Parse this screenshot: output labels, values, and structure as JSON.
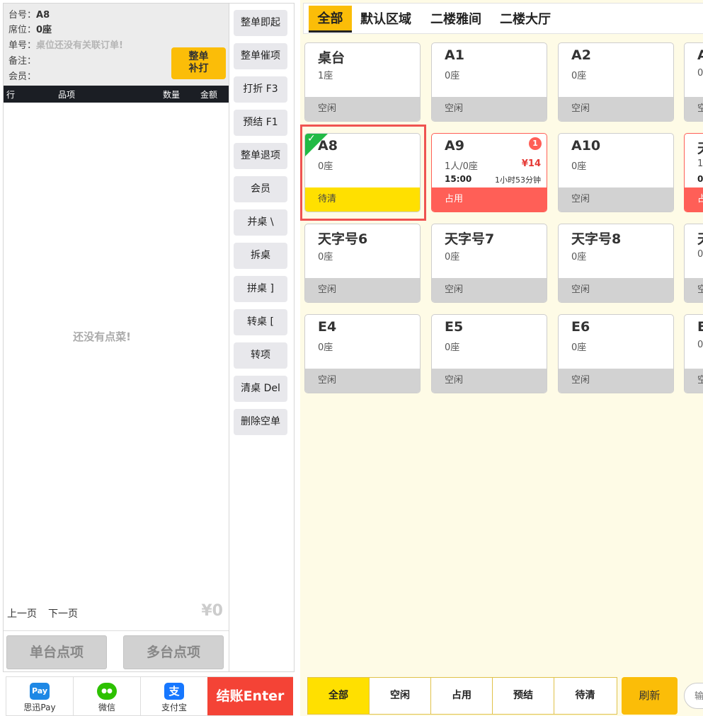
{
  "order": {
    "table_label": "台号：",
    "table_value": "A8",
    "seat_label": "席位：",
    "seat_value": "0座",
    "bill_label": "单号：",
    "bill_value": "桌位还没有关联订单!",
    "note_label": "备注：",
    "member_label": "会员：",
    "reprint_line1": "整单",
    "reprint_line2": "补打",
    "columns": [
      "行",
      "品项",
      "数量",
      "金额"
    ],
    "empty_text": "还没有点菜!",
    "prev_page": "上一页",
    "next_page": "下一页",
    "total": "¥0",
    "single_order": "单台点项",
    "multi_order": "多台点项"
  },
  "actions": [
    "整单即起",
    "整单催项",
    "打折 F3",
    "预结 F1",
    "整单退项",
    "会员",
    "并桌 \\",
    "拆桌",
    "拼桌 ]",
    "转桌 [",
    "转项",
    "清桌 Del",
    "删除空单"
  ],
  "payments": [
    {
      "label": "思迅Pay",
      "icon": "sixun-pay-icon",
      "icon_text": "Pay",
      "color": "#1e88e5"
    },
    {
      "label": "微信",
      "icon": "wechat-icon",
      "icon_text": "●●",
      "color": "#2dc100"
    },
    {
      "label": "支付宝",
      "icon": "alipay-icon",
      "icon_text": "支",
      "color": "#1677ff"
    }
  ],
  "checkout": "结账Enter",
  "area_tabs": [
    "全部",
    "默认区域",
    "二楼雅间",
    "二楼大厅"
  ],
  "tables": [
    {
      "name": "桌台",
      "seats": "1座",
      "status": "空闲",
      "type": "free"
    },
    {
      "name": "A1",
      "seats": "0座",
      "status": "空闲",
      "type": "free"
    },
    {
      "name": "A2",
      "seats": "0座",
      "status": "空闲",
      "type": "free"
    },
    {
      "name": "A",
      "seats": "0",
      "status": "空",
      "type": "free"
    },
    {
      "name": "A8",
      "seats": "0座",
      "status": "待清",
      "type": "pend"
    },
    {
      "name": "A9",
      "seats": "1人/0座",
      "status": "占用",
      "type": "occ",
      "price": "¥14",
      "time": "15:00",
      "duration": "1小时53分钟",
      "badge": "1"
    },
    {
      "name": "A10",
      "seats": "0座",
      "status": "空闲",
      "type": "free"
    },
    {
      "name": "天",
      "seats": "1",
      "status": "占",
      "type": "occ",
      "time": "0"
    },
    {
      "name": "天字号6",
      "seats": "0座",
      "status": "空闲",
      "type": "free"
    },
    {
      "name": "天字号7",
      "seats": "0座",
      "status": "空闲",
      "type": "free"
    },
    {
      "name": "天字号8",
      "seats": "0座",
      "status": "空闲",
      "type": "free"
    },
    {
      "name": "天",
      "seats": "0",
      "status": "空",
      "type": "free"
    },
    {
      "name": "E4",
      "seats": "0座",
      "status": "空闲",
      "type": "free"
    },
    {
      "name": "E5",
      "seats": "0座",
      "status": "空闲",
      "type": "free"
    },
    {
      "name": "E6",
      "seats": "0座",
      "status": "空闲",
      "type": "free"
    },
    {
      "name": "E",
      "seats": "0",
      "status": "空",
      "type": "free"
    }
  ],
  "filters": [
    "全部",
    "空闲",
    "占用",
    "预结",
    "待清"
  ],
  "refresh": "刷新",
  "search_placeholder": "输"
}
